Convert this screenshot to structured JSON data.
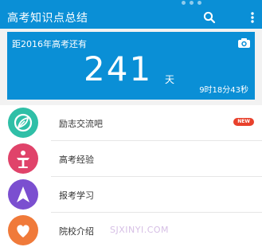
{
  "app": {
    "title": "高考知识点总结",
    "colors": {
      "primary": "#0a8fd6",
      "badge": "#e8412c"
    }
  },
  "toolbar": {
    "search_icon": "search-icon",
    "more_icon": "more-vertical-icon"
  },
  "countdown": {
    "label": "距2016年高考还有",
    "days": "241",
    "unit": "天",
    "remaining_time": "9时18分43秒",
    "camera_icon": "camera-icon"
  },
  "menu": {
    "items": [
      {
        "label": "励志交流吧",
        "icon": "chat-leaf-icon",
        "color": "#2fbfa7",
        "badge": "NEW"
      },
      {
        "label": "高考经验",
        "icon": "podium-icon",
        "color": "#e0436a"
      },
      {
        "label": "报考学习",
        "icon": "compass-arrow-icon",
        "color": "#7b4fd0"
      },
      {
        "label": "院校介绍",
        "icon": "heart-icon",
        "color": "#f07a3a"
      }
    ]
  },
  "watermark": {
    "text": "SJXINYI.COM"
  }
}
